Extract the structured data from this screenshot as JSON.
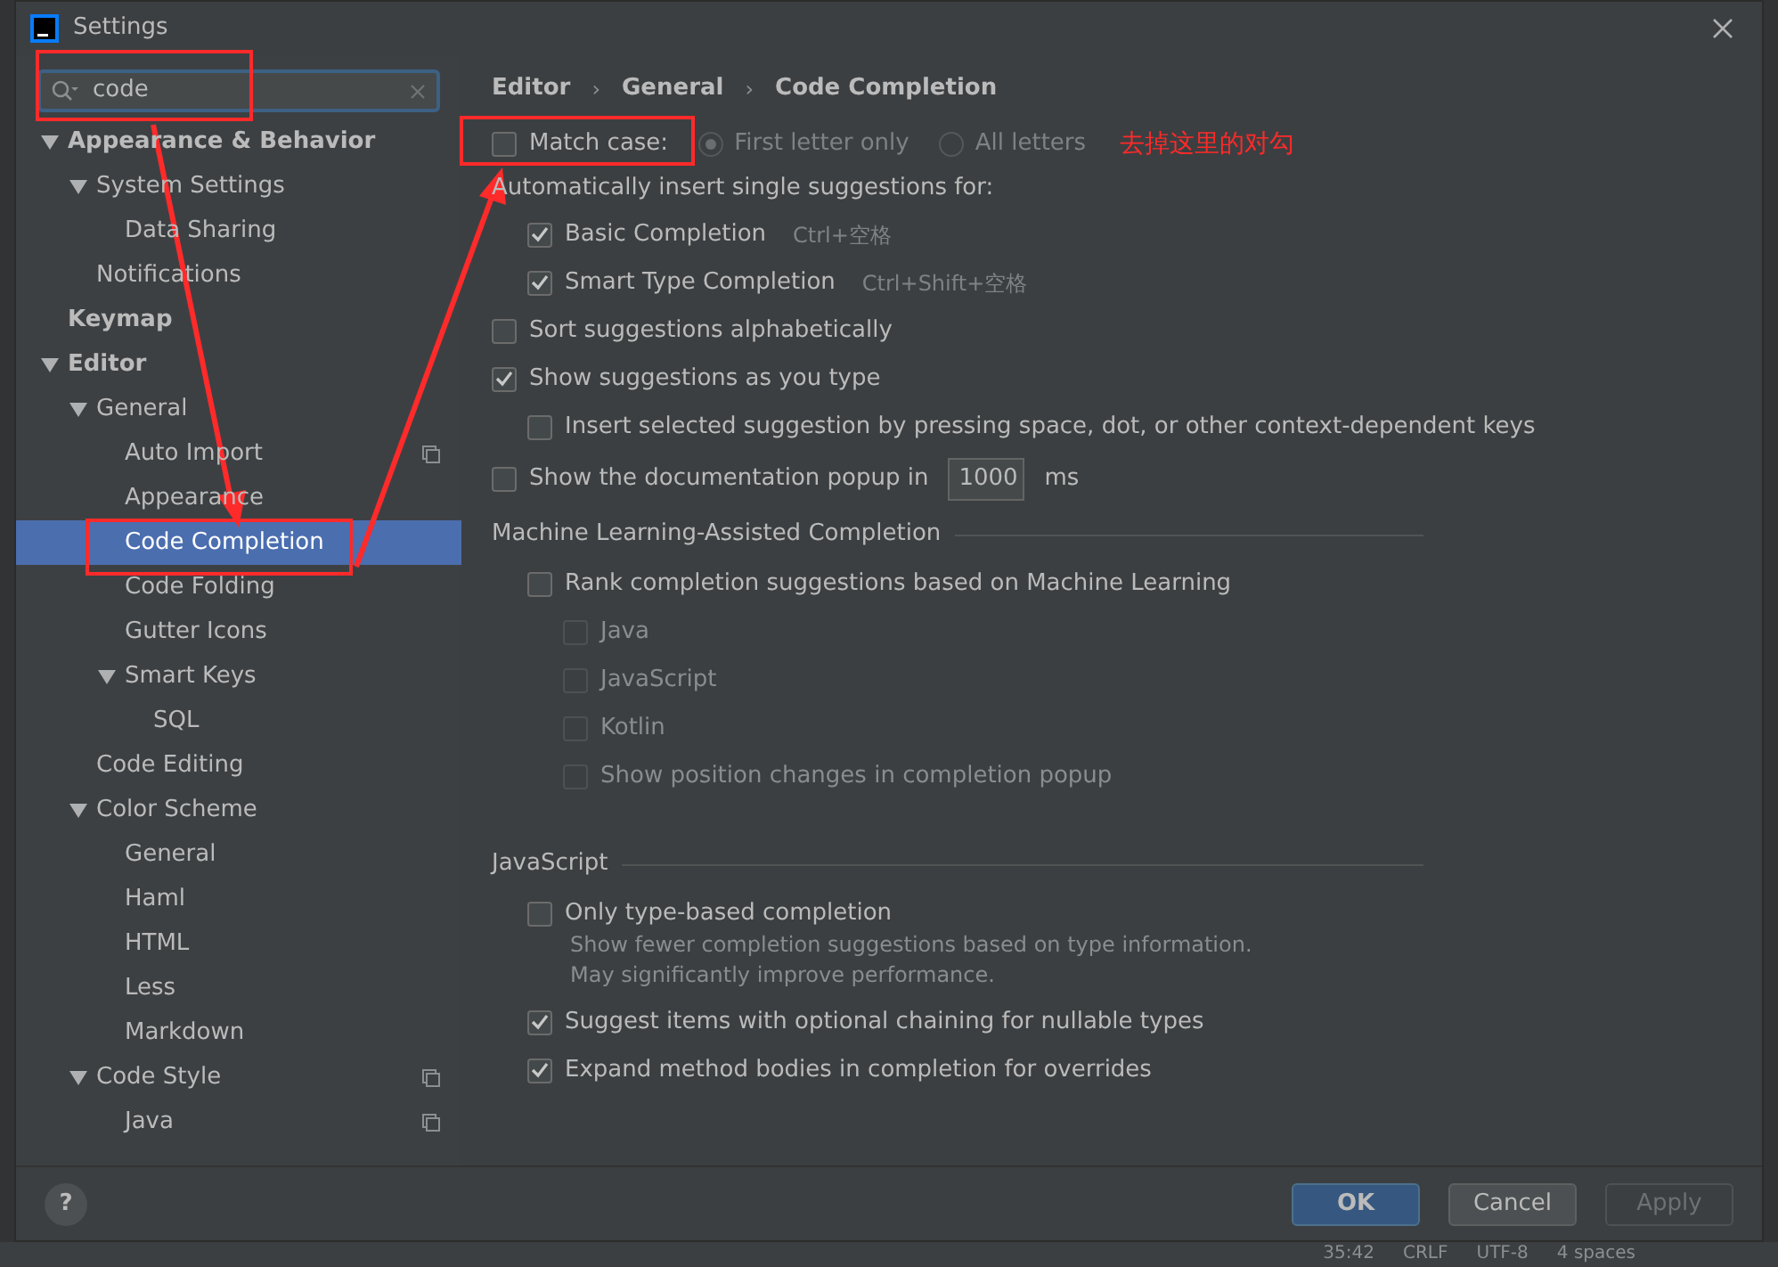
{
  "window": {
    "title": "Settings"
  },
  "search": {
    "value": "code"
  },
  "tree": [
    {
      "label": "Appearance & Behavior",
      "bold": true,
      "expanded": true,
      "selected": false,
      "children": [
        {
          "label": "System Settings",
          "expanded": true,
          "selected": false,
          "children": [
            {
              "label": "Data Sharing",
              "selected": false
            }
          ]
        },
        {
          "label": "Notifications",
          "selected": false
        }
      ]
    },
    {
      "label": "Keymap",
      "bold": true,
      "selected": false
    },
    {
      "label": "Editor",
      "bold": true,
      "expanded": true,
      "selected": false,
      "children": [
        {
          "label": "General",
          "expanded": true,
          "selected": false,
          "children": [
            {
              "label": "Auto Import",
              "scoped": true,
              "selected": false
            },
            {
              "label": "Appearance",
              "selected": false
            },
            {
              "label": "Code Completion",
              "selected": true
            },
            {
              "label": "Code Folding",
              "selected": false
            },
            {
              "label": "Gutter Icons",
              "selected": false
            },
            {
              "label": "Smart Keys",
              "expanded": true,
              "selected": false,
              "children": [
                {
                  "label": "SQL",
                  "selected": false
                }
              ]
            }
          ]
        },
        {
          "label": "Code Editing",
          "selected": false
        },
        {
          "label": "Color Scheme",
          "expanded": true,
          "selected": false,
          "children": [
            {
              "label": "General",
              "selected": false
            },
            {
              "label": "Haml",
              "selected": false
            },
            {
              "label": "HTML",
              "selected": false
            },
            {
              "label": "Less",
              "selected": false
            },
            {
              "label": "Markdown",
              "selected": false
            }
          ]
        },
        {
          "label": "Code Style",
          "expanded": true,
          "scoped": true,
          "selected": false,
          "children": [
            {
              "label": "Java",
              "scoped": true,
              "selected": false
            }
          ]
        }
      ]
    }
  ],
  "breadcrumb": [
    {
      "label": "Editor"
    },
    {
      "separator": "›",
      "label": "General"
    },
    {
      "separator": "›",
      "label": "Code Completion"
    }
  ],
  "help": {
    "label": "?"
  },
  "options": [
    {
      "kind": "match",
      "label": "Match case:",
      "checked": false,
      "radios": [
        {
          "label": "First letter only",
          "selected": true
        },
        {
          "label": "All letters",
          "selected": false
        }
      ]
    },
    {
      "kind": "label",
      "label": "Automatically insert single suggestions for:",
      "children": [
        {
          "kind": "checkbox",
          "label": "Basic Completion",
          "hint": "Ctrl+空格",
          "checked": true,
          "disabled": false
        },
        {
          "kind": "checkbox",
          "label": "Smart Type Completion",
          "hint": "Ctrl+Shift+空格",
          "checked": true,
          "disabled": false
        }
      ]
    },
    {
      "kind": "checkbox",
      "label": "Sort suggestions alphabetically",
      "checked": false,
      "disabled": false
    },
    {
      "kind": "checkbox",
      "label": "Show suggestions as you type",
      "checked": true,
      "disabled": false,
      "children": [
        {
          "kind": "checkbox",
          "label": "Insert selected suggestion by pressing space, dot, or other context-dependent keys",
          "checked": false,
          "disabled": false
        }
      ]
    },
    {
      "kind": "number",
      "label": "Show the documentation popup in",
      "checked": false,
      "disabled": false,
      "value": "1000",
      "unit": "ms"
    },
    {
      "kind": "section",
      "label": "Machine Learning-Assisted Completion",
      "children": [
        {
          "kind": "checkbox",
          "label": "Rank completion suggestions based on Machine Learning",
          "checked": false,
          "disabled": false,
          "children": [
            {
              "kind": "checkbox",
              "label": "Java",
              "checked": false,
              "disabled": true
            },
            {
              "kind": "checkbox",
              "label": "JavaScript",
              "checked": false,
              "disabled": true
            },
            {
              "kind": "checkbox",
              "label": "Kotlin",
              "checked": false,
              "disabled": true
            },
            {
              "kind": "checkbox",
              "label": "Show position changes in completion popup",
              "checked": false,
              "disabled": true
            }
          ]
        }
      ]
    },
    {
      "kind": "section",
      "label": "JavaScript",
      "children": [
        {
          "kind": "checkbox",
          "label": "Only type-based completion",
          "checked": false,
          "disabled": false,
          "description": "Show fewer completion suggestions based on type information. May significantly improve performance."
        },
        {
          "kind": "checkbox",
          "label": "Suggest items with optional chaining for nullable types",
          "checked": true,
          "disabled": false
        },
        {
          "kind": "checkbox",
          "label": "Expand method bodies in completion for overrides",
          "checked": true,
          "disabled": false
        }
      ]
    }
  ],
  "annotation": {
    "text": "去掉这里的对勾"
  },
  "buttons": [
    {
      "label": "OK",
      "kind": "primary",
      "disabled": false
    },
    {
      "label": "Cancel",
      "kind": "normal",
      "disabled": false
    },
    {
      "label": "Apply",
      "kind": "normal",
      "disabled": true
    }
  ],
  "status_bar": [
    "35:42",
    "CRLF",
    "UTF-8",
    "4 spaces"
  ]
}
